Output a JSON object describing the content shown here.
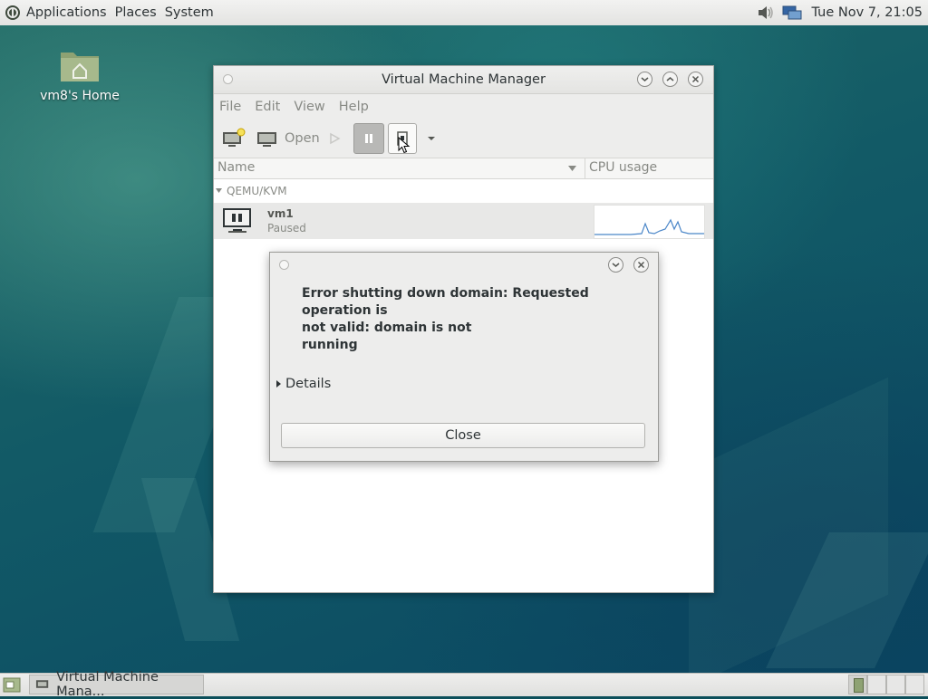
{
  "top_panel": {
    "menus": [
      "Applications",
      "Places",
      "System"
    ],
    "clock": "Tue Nov 7, 21:05"
  },
  "desktop": {
    "home_icon_label": "vm8's Home"
  },
  "vmm_window": {
    "title": "Virtual Machine Manager",
    "menu": [
      "File",
      "Edit",
      "View",
      "Help"
    ],
    "toolbar": {
      "open_label": "Open"
    },
    "columns": {
      "name": "Name",
      "cpu": "CPU usage"
    },
    "group": "QEMU/KVM",
    "vm": {
      "name": "vm1",
      "status": "Paused"
    }
  },
  "dialog": {
    "message_line1": "Error shutting down domain: Requested operation is",
    "message_line2": "not valid: domain is not",
    "message_line3": "running",
    "details_label": "Details",
    "close_label": "Close"
  },
  "taskbar": {
    "task_label": "Virtual Machine Mana..."
  },
  "colors": {
    "accent": "#4a90d9",
    "sparkline": "#4a86c8"
  }
}
